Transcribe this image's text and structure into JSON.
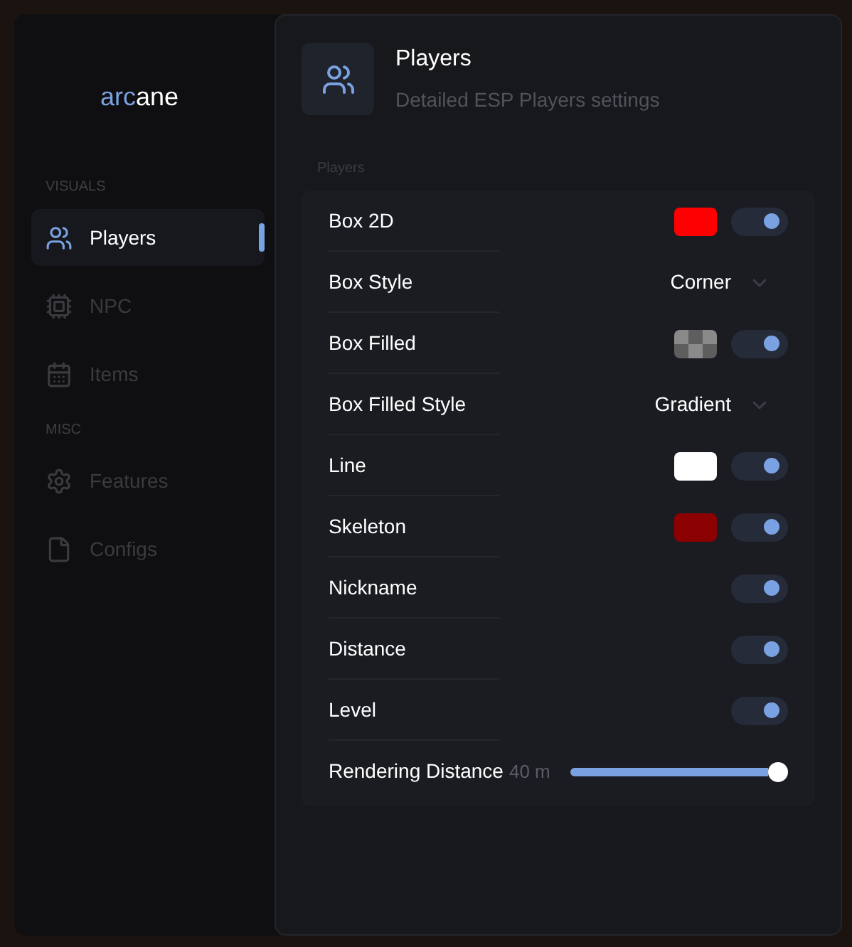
{
  "logo": {
    "accent": "arc",
    "rest": "ane"
  },
  "sidebar": {
    "sections": [
      {
        "title": "VISUALS",
        "items": [
          {
            "label": "Players",
            "selected": true
          },
          {
            "label": "NPC",
            "selected": false
          },
          {
            "label": "Items",
            "selected": false
          }
        ]
      },
      {
        "title": "MISC",
        "items": [
          {
            "label": "Features",
            "selected": false
          },
          {
            "label": "Configs",
            "selected": false
          }
        ]
      }
    ]
  },
  "header": {
    "title": "Players",
    "subtitle": "Detailed ESP Players settings"
  },
  "group": {
    "title": "Players",
    "rows": [
      {
        "kind": "toggle",
        "label": "Box 2D",
        "swatch": {
          "kind": "solid",
          "color": "#ff0000"
        },
        "on": true
      },
      {
        "kind": "dropdown",
        "label": "Box Style",
        "value": "Corner"
      },
      {
        "kind": "toggle",
        "label": "Box Filled",
        "swatch": {
          "kind": "checker"
        },
        "on": true
      },
      {
        "kind": "dropdown",
        "label": "Box Filled Style",
        "value": "Gradient"
      },
      {
        "kind": "toggle",
        "label": "Line",
        "swatch": {
          "kind": "solid",
          "color": "#ffffff"
        },
        "on": true
      },
      {
        "kind": "toggle",
        "label": "Skeleton",
        "swatch": {
          "kind": "solid",
          "color": "#8b0000"
        },
        "on": true
      },
      {
        "kind": "toggle",
        "label": "Nickname",
        "on": true
      },
      {
        "kind": "toggle",
        "label": "Distance",
        "on": true
      },
      {
        "kind": "toggle",
        "label": "Level",
        "on": true
      },
      {
        "kind": "slider",
        "label": "Rendering Distance",
        "reading": "40 m"
      }
    ]
  }
}
